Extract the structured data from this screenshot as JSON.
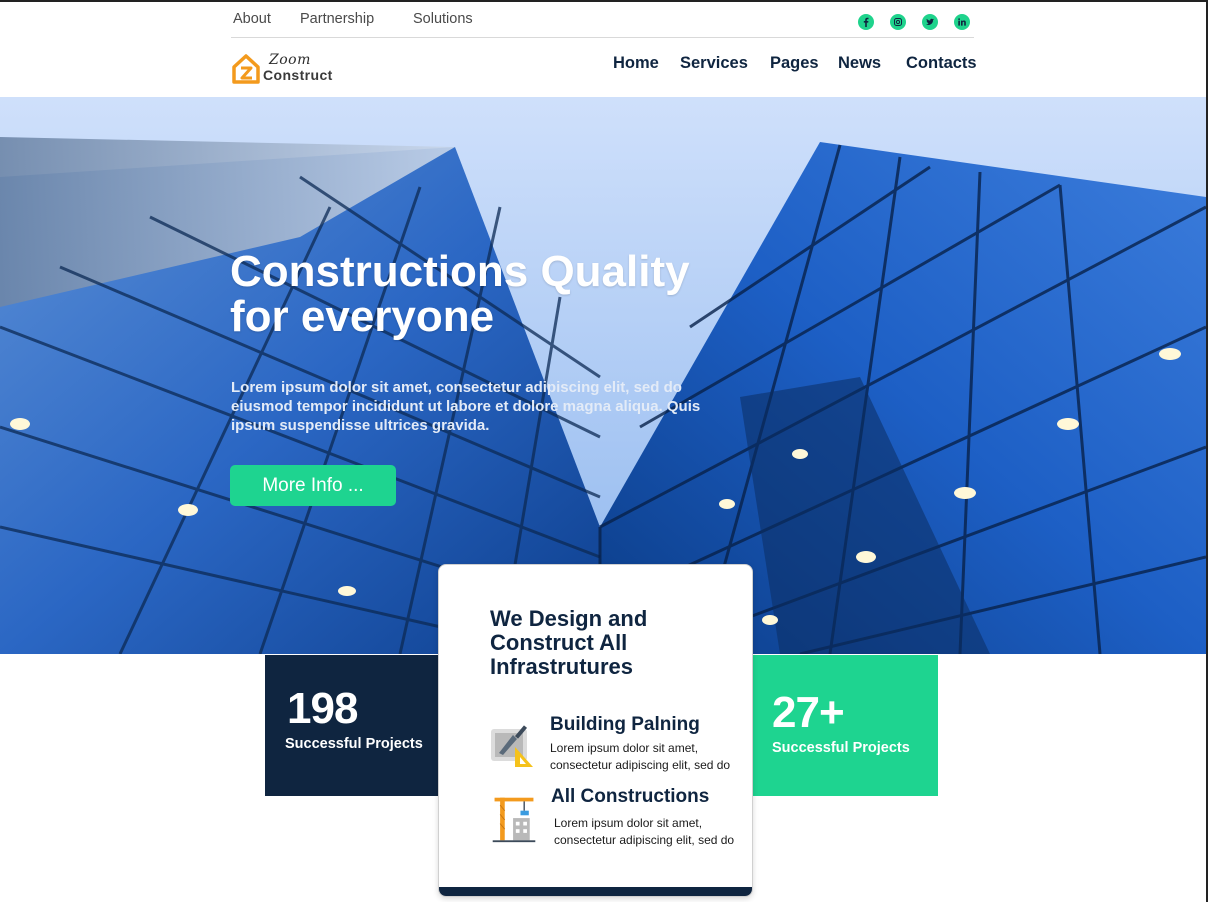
{
  "topbar": {
    "links": [
      "About",
      "Partnership",
      "Solutions"
    ],
    "social": [
      "facebook-icon",
      "instagram-icon",
      "twitter-icon",
      "linkedin-icon"
    ]
  },
  "brand": {
    "line1": "Zoom",
    "line2": "Construct",
    "accent": "#f39a1d"
  },
  "nav": [
    "Home",
    "Services",
    "Pages",
    "News",
    "Contacts"
  ],
  "hero": {
    "title": "Constructions Quality for everyone",
    "text": "Lorem ipsum dolor sit amet, consectetur adipiscing elit, sed do eiusmod tempor incididunt ut labore et dolore magna aliqua. Quis ipsum suspendisse ultrices gravida.",
    "button": "More Info ..."
  },
  "stats": [
    {
      "number": "198",
      "label": "Successful Projects"
    },
    {
      "number": "27+",
      "label": "Successful Projects"
    }
  ],
  "card": {
    "title": "We Design and Construct All Infrastrutures",
    "features": [
      {
        "icon": "blueprint-icon",
        "title": "Building Palning",
        "text": "Lorem ipsum dolor sit amet, consectetur adipiscing elit, sed do"
      },
      {
        "icon": "crane-icon",
        "title": "All Constructions",
        "text": "Lorem ipsum dolor sit amet, consectetur adipiscing elit, sed do"
      }
    ]
  },
  "colors": {
    "navy": "#0f2540",
    "green": "#1ed490",
    "orange": "#f39a1d"
  }
}
